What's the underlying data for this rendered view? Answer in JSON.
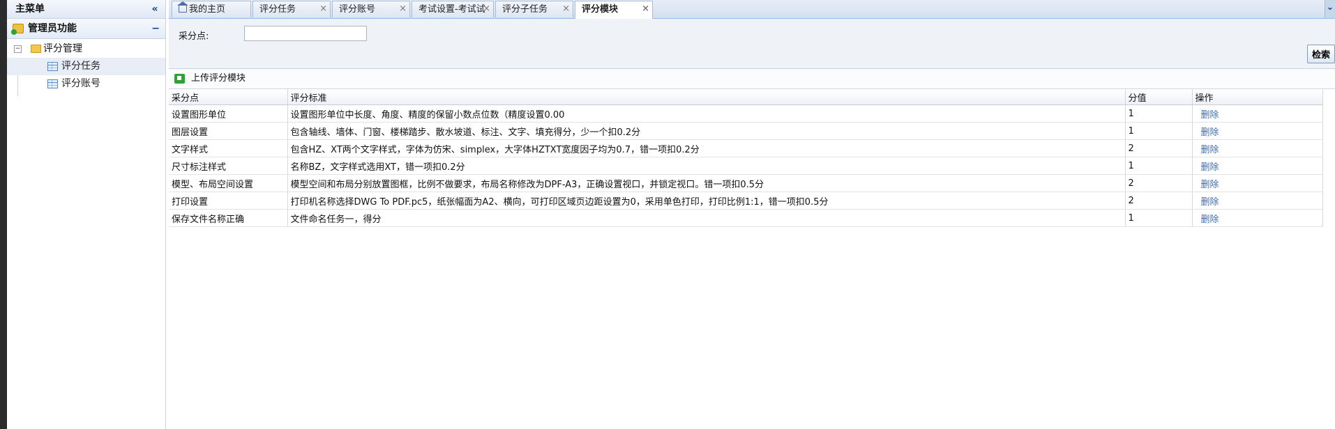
{
  "sidebar": {
    "title": "主菜单",
    "collapse_glyph": "«",
    "group": {
      "label": "管理员功能",
      "toggle": "−"
    },
    "tree": {
      "root": {
        "label": "评分管理",
        "toggle": "−"
      },
      "children": [
        {
          "label": "评分任务",
          "selected": true
        },
        {
          "label": "评分账号",
          "selected": false
        }
      ]
    }
  },
  "tabs": [
    {
      "label": "我的主页",
      "closable": false,
      "icon": "home-icon"
    },
    {
      "label": "评分任务",
      "closable": true
    },
    {
      "label": "评分账号",
      "closable": true
    },
    {
      "label": "考试设置-考试试卷",
      "closable": true
    },
    {
      "label": "评分子任务",
      "closable": true
    },
    {
      "label": "评分模块",
      "closable": true,
      "active": true
    }
  ],
  "tab_close_glyph": "×",
  "tab_scroll_glyph": "⌄",
  "search": {
    "label": "采分点:",
    "value": "",
    "placeholder": "",
    "button": "检索"
  },
  "toolbar": {
    "upload_label": "上传评分模块",
    "upload_icon": "upload-icon"
  },
  "table": {
    "columns": [
      "采分点",
      "评分标准",
      "分值",
      "操作"
    ],
    "rows": [
      {
        "point": "设置图形单位",
        "criteria": "设置图形单位中长度、角度、精度的保留小数点位数（精度设置0.00",
        "score": "1",
        "action": "删除"
      },
      {
        "point": "图层设置",
        "criteria": "包含轴线、墙体、门窗、楼梯踏步、散水坡道、标注、文字、填充得分，少一个扣0.2分",
        "score": "1",
        "action": "删除"
      },
      {
        "point": "文字样式",
        "criteria": "包含HZ、XT两个文字样式，字体为仿宋、simplex，大字体HZTXT宽度因子均为0.7，错一项扣0.2分",
        "score": "2",
        "action": "删除"
      },
      {
        "point": "尺寸标注样式",
        "criteria": "名称BZ，文字样式选用XT，错一项扣0.2分",
        "score": "1",
        "action": "删除"
      },
      {
        "point": "模型、布局空间设置",
        "criteria": "模型空间和布局分别放置图框，比例不做要求，布局名称修改为DPF-A3，正确设置视口，并锁定视口。错一项扣0.5分",
        "score": "2",
        "action": "删除"
      },
      {
        "point": "打印设置",
        "criteria": "打印机名称选择DWG To PDF.pc5，纸张幅面为A2、横向，可打印区域页边距设置为0，采用单色打印，打印比例1:1，错一项扣0.5分",
        "score": "2",
        "action": "删除"
      },
      {
        "point": "保存文件名称正确",
        "criteria": "文件命名任务一，得分",
        "score": "1",
        "action": "删除"
      }
    ]
  }
}
